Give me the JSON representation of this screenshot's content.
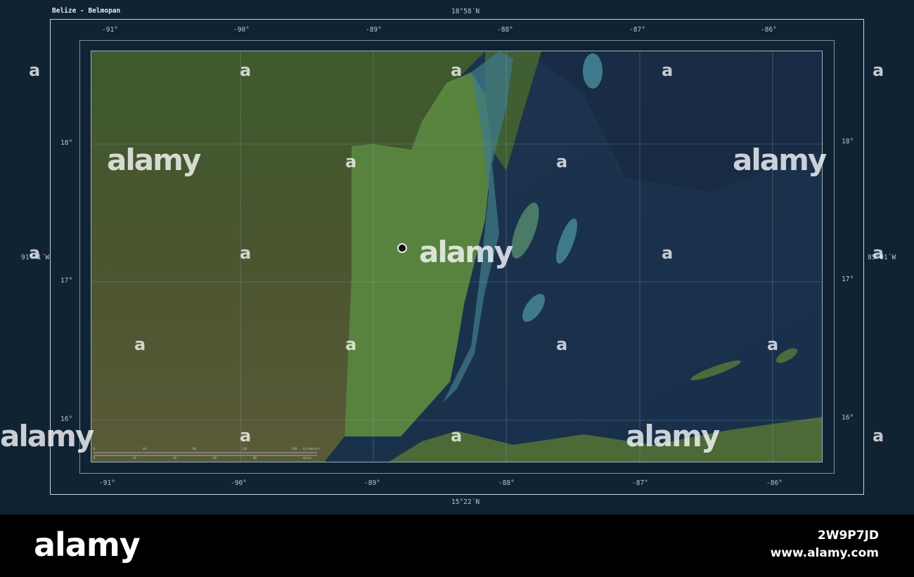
{
  "map": {
    "title": "Belize - Belmopan",
    "top_coord": "18°58´N",
    "bottom_coord": "15°22´N",
    "left_coord": "91°41´W",
    "right_coord": "85°01´W",
    "top_lon_ticks": [
      "-91°",
      "-90°",
      "-89°",
      "-88°",
      "-87°",
      "-86°"
    ],
    "bottom_lon_ticks": [
      "-91°",
      "-90°",
      "-89°",
      "-88°",
      "-87°",
      "-86°"
    ],
    "left_lat_ticks": [
      "18°",
      "17°",
      "16°"
    ],
    "right_lat_ticks": [
      "18°",
      "17°",
      "16°"
    ],
    "scale": {
      "km_label": "kilometers",
      "mi_label": "miles",
      "km_ticks": [
        "0",
        "40",
        "80",
        "120",
        "160"
      ],
      "mi_ticks": [
        "0",
        "20",
        "40",
        "60",
        "80"
      ]
    },
    "colors": {
      "panel": "#0f2333",
      "land": "#3e5a2e",
      "highlight": "#5f8f3f",
      "sea": "#1c3550",
      "frame": "#c8d3dc"
    }
  },
  "watermark": {
    "overlay_text": "alamy",
    "small_mark": "a",
    "brand": "alamy",
    "image_id": "2W9P7JD",
    "url": "www.alamy.com"
  }
}
